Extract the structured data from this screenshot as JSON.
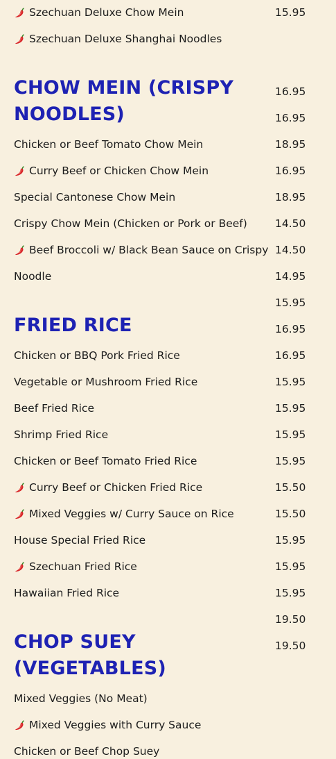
{
  "left_column": [
    {
      "type": "item",
      "text": "Szechuan Deluxe Chow Mein",
      "spicy": true
    },
    {
      "type": "item",
      "text": "Szechuan Deluxe Shanghai Noodles",
      "spicy": true
    },
    {
      "type": "heading",
      "lines": [
        "CHOW MEIN (CRISPY",
        "NOODLES)"
      ]
    },
    {
      "type": "item",
      "text": "Chicken or Beef Tomato Chow Mein",
      "spicy": false
    },
    {
      "type": "item",
      "text": "Curry Beef or Chicken Chow Mein",
      "spicy": true
    },
    {
      "type": "item",
      "text": "Special Cantonese Chow Mein",
      "spicy": false
    },
    {
      "type": "item",
      "text": "Crispy Chow Mein (Chicken or Pork or Beef)",
      "spicy": false
    },
    {
      "type": "item",
      "text": "Beef Broccoli w/ Black Bean Sauce on Crispy",
      "spicy": true
    },
    {
      "type": "item",
      "text": "Noodle",
      "spicy": false
    },
    {
      "type": "heading",
      "lines": [
        "FRIED RICE"
      ]
    },
    {
      "type": "item",
      "text": "Chicken or BBQ Pork Fried Rice",
      "spicy": false
    },
    {
      "type": "item",
      "text": "Vegetable or Mushroom Fried Rice",
      "spicy": false
    },
    {
      "type": "item",
      "text": "Beef Fried Rice",
      "spicy": false
    },
    {
      "type": "item",
      "text": "Shrimp Fried Rice",
      "spicy": false
    },
    {
      "type": "item",
      "text": "Chicken or Beef Tomato Fried Rice",
      "spicy": false
    },
    {
      "type": "item",
      "text": "Curry Beef or Chicken Fried Rice",
      "spicy": true
    },
    {
      "type": "item",
      "text": "Mixed Veggies w/ Curry Sauce on Rice",
      "spicy": true
    },
    {
      "type": "item",
      "text": "House Special Fried Rice",
      "spicy": false
    },
    {
      "type": "item",
      "text": "Szechuan Fried Rice",
      "spicy": true
    },
    {
      "type": "item",
      "text": "Hawaiian Fried Rice",
      "spicy": false
    },
    {
      "type": "heading",
      "lines": [
        "CHOP SUEY",
        "(VEGETABLES)"
      ]
    },
    {
      "type": "item",
      "text": "Mixed Veggies (No Meat)",
      "spicy": false
    },
    {
      "type": "item",
      "text": "Mixed Veggies with Curry Sauce",
      "spicy": true
    },
    {
      "type": "item",
      "text": "Chicken or Beef Chop Suey",
      "spicy": false
    }
  ],
  "prices": [
    "15.95",
    "16.95",
    "16.95",
    "18.95",
    "16.95",
    "18.95",
    "14.50",
    "14.50",
    "14.95",
    "15.95",
    "16.95",
    "16.95",
    "15.95",
    "15.95",
    "15.95",
    "15.95",
    "15.50",
    "15.50",
    "15.95",
    "15.95",
    "15.95",
    "19.50",
    "19.50"
  ],
  "colors": {
    "heading": "#1e22b3",
    "background": "#f8f0df",
    "text": "#1c1c1c"
  },
  "icons": {
    "spicy": "chili-pepper-icon"
  }
}
